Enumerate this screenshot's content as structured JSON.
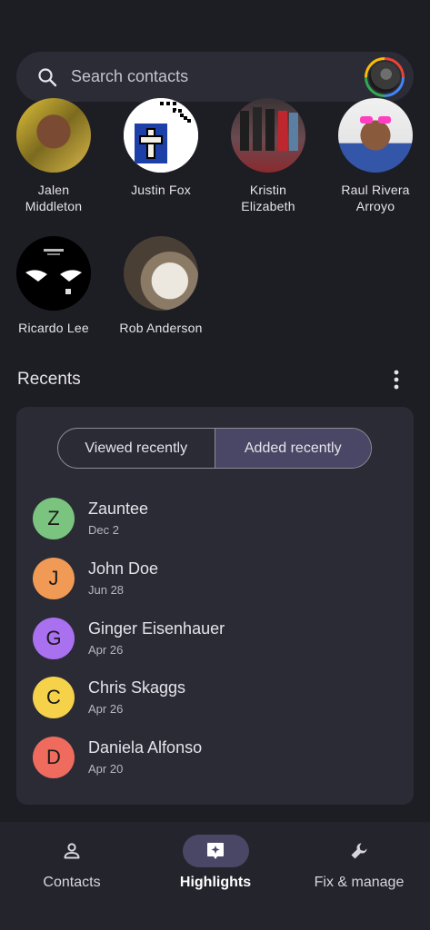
{
  "search": {
    "placeholder": "Search contacts"
  },
  "favorites": [
    {
      "name": "Jalen Middleton"
    },
    {
      "name": "Justin Fox"
    },
    {
      "name": "Kristin Elizabeth"
    },
    {
      "name": "Raul Rivera Arroyo"
    },
    {
      "name": "Ricardo Lee"
    },
    {
      "name": "Rob Anderson"
    }
  ],
  "recents": {
    "title": "Recents",
    "tabs": {
      "viewed": "Viewed recently",
      "added": "Added recently"
    },
    "items": [
      {
        "initial": "Z",
        "name": "Zauntee",
        "date": "Dec 2",
        "color": "#7bc47f"
      },
      {
        "initial": "J",
        "name": "John Doe",
        "date": "Jun 28",
        "color": "#f09a55"
      },
      {
        "initial": "G",
        "name": "Ginger Eisenhauer",
        "date": "Apr 26",
        "color": "#a970f0"
      },
      {
        "initial": "C",
        "name": "Chris Skaggs",
        "date": "Apr 26",
        "color": "#f6d24a"
      },
      {
        "initial": "D",
        "name": "Daniela Alfonso",
        "date": "Apr 20",
        "color": "#ee6b5e"
      }
    ]
  },
  "nav": {
    "contacts": "Contacts",
    "highlights": "Highlights",
    "fix": "Fix & manage"
  }
}
